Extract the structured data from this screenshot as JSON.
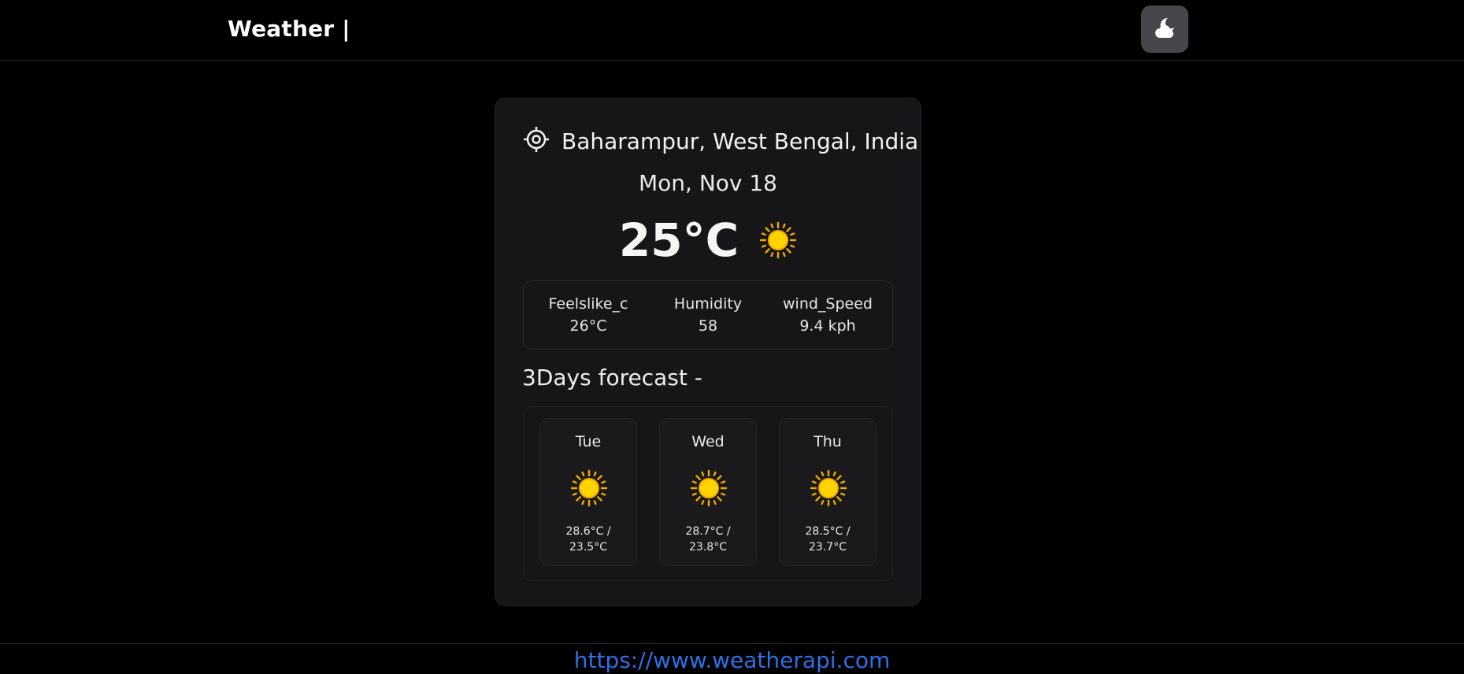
{
  "header": {
    "brand": "Weather |",
    "theme_toggle_icon": "cloud-moon-icon"
  },
  "current": {
    "location": "Baharampur, West Bengal, India",
    "location_icon": "location-target-icon",
    "date": "Mon, Nov 18",
    "temperature": "25°C",
    "condition_icon": "sun-icon"
  },
  "stats": [
    {
      "label": "Feelslike_c",
      "value": "26°C"
    },
    {
      "label": "Humidity",
      "value": "58"
    },
    {
      "label": "wind_Speed",
      "value": "9.4 kph"
    }
  ],
  "forecast": {
    "title": "3Days forecast -",
    "days": [
      {
        "day": "Tue",
        "max": "28.6°C /",
        "min": "23.5°C",
        "icon": "sun-icon"
      },
      {
        "day": "Wed",
        "max": "28.7°C /",
        "min": "23.8°C",
        "icon": "sun-icon"
      },
      {
        "day": "Thu",
        "max": "28.5°C /",
        "min": "23.7°C",
        "icon": "sun-icon"
      }
    ]
  },
  "footer": {
    "link_text": "https://www.weatherapi.com"
  },
  "colors": {
    "background": "#000000",
    "card": "#161618",
    "sun": "#f7c600",
    "link": "#2f6fe6",
    "theme_button": "#46464b"
  }
}
